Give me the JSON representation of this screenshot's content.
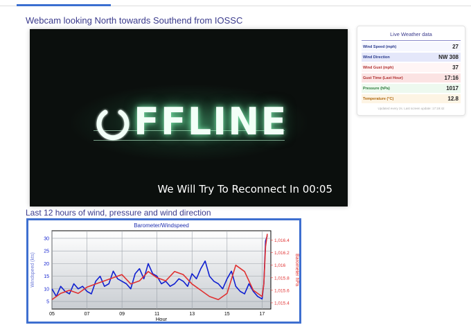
{
  "webcam": {
    "title": "Webcam looking North towards Southend from IOSSC",
    "offline_text": "FFLINE",
    "reconnect_text": "We Will Try To Reconnect In 00:05"
  },
  "graph_section": {
    "title": "Last 12 hours of wind, pressure and wind direction"
  },
  "weather": {
    "title": "Live Weather data",
    "rows": [
      {
        "label": "Wind Speed (mph)",
        "value": "27",
        "bg": "#f6f7ff",
        "color": "#2a3a8c"
      },
      {
        "label": "Wind Direction",
        "value": "NW 308",
        "bg": "#e4e7fa",
        "color": "#2a3a8c"
      },
      {
        "label": "Wind Gust (mph)",
        "value": "37",
        "bg": "#fff5f5",
        "color": "#b03030"
      },
      {
        "label": "Gust Time (Last Hour)",
        "value": "17:16",
        "bg": "#fbe3e3",
        "color": "#b03030"
      },
      {
        "label": "Pressure (hPa)",
        "value": "1017",
        "bg": "#edf9ef",
        "color": "#2a7a3a"
      },
      {
        "label": "Temperature (°C)",
        "value": "12.8",
        "bg": "#fdf4e4",
        "color": "#b06a10"
      }
    ],
    "footer": "Updated every 2s. Last screen update: 17:19:42"
  },
  "chart_data": {
    "type": "line",
    "title": "Barometer/Windspeed",
    "xlabel": "Hour",
    "ylabel_left": "Windspeed (kts)",
    "ylabel_right": "Barometer hPa",
    "x_ticks": [
      "05",
      "07",
      "09",
      "11",
      "13",
      "15",
      "17"
    ],
    "x_range": [
      5,
      17.5
    ],
    "y_left_ticks": [
      "5",
      "10",
      "15",
      "20",
      "25",
      "30"
    ],
    "y_left_range": [
      2,
      33
    ],
    "y_right_ticks": [
      "1,015.4",
      "1,015.6",
      "1,015.8",
      "1,016",
      "1,016.2",
      "1,016.4"
    ],
    "y_right_range": [
      1015.3,
      1016.55
    ],
    "grid": true,
    "colors": {
      "wind": "#1020d0",
      "pressure": "#e03030"
    },
    "series": [
      {
        "axis": "left",
        "x": [
          5.0,
          5.25,
          5.5,
          5.75,
          6.0,
          6.25,
          6.5,
          6.75,
          7.0,
          7.25,
          7.5,
          7.75,
          8.0,
          8.25,
          8.5,
          8.75,
          9.0,
          9.25,
          9.5,
          9.75,
          10.0,
          10.25,
          10.5,
          10.75,
          11.0,
          11.25,
          11.5,
          11.75,
          12.0,
          12.25,
          12.5,
          12.75,
          13.0,
          13.25,
          13.5,
          13.75,
          14.0,
          14.25,
          14.5,
          14.75,
          15.0,
          15.25,
          15.5,
          15.75,
          16.0,
          16.25,
          16.5,
          16.75,
          17.0,
          17.1,
          17.2,
          17.3
        ],
        "values": [
          10,
          7,
          11,
          9,
          8,
          12,
          10,
          11,
          9,
          8,
          13,
          15,
          11,
          12,
          17,
          14,
          13,
          12,
          10,
          16,
          18,
          14,
          20,
          16,
          15,
          12,
          13,
          11,
          12,
          14,
          13,
          11,
          16,
          14,
          18,
          21,
          15,
          13,
          12,
          10,
          14,
          17,
          11,
          9,
          8,
          12,
          9,
          7,
          6,
          12,
          29,
          31
        ]
      },
      {
        "axis": "right",
        "x": [
          5.0,
          5.5,
          6.0,
          6.5,
          7.0,
          7.5,
          8.0,
          8.5,
          9.0,
          9.5,
          10.0,
          10.5,
          11.0,
          11.5,
          12.0,
          12.5,
          13.0,
          13.5,
          14.0,
          14.5,
          15.0,
          15.5,
          16.0,
          16.5,
          17.0,
          17.1,
          17.2,
          17.3
        ],
        "values": [
          1015.45,
          1015.55,
          1015.6,
          1015.55,
          1015.65,
          1015.7,
          1015.75,
          1015.8,
          1015.85,
          1015.7,
          1015.75,
          1015.9,
          1015.8,
          1015.75,
          1015.9,
          1015.85,
          1015.7,
          1015.6,
          1015.5,
          1015.45,
          1015.55,
          1016.0,
          1015.9,
          1015.6,
          1015.5,
          1015.7,
          1016.3,
          1016.5
        ]
      }
    ]
  }
}
